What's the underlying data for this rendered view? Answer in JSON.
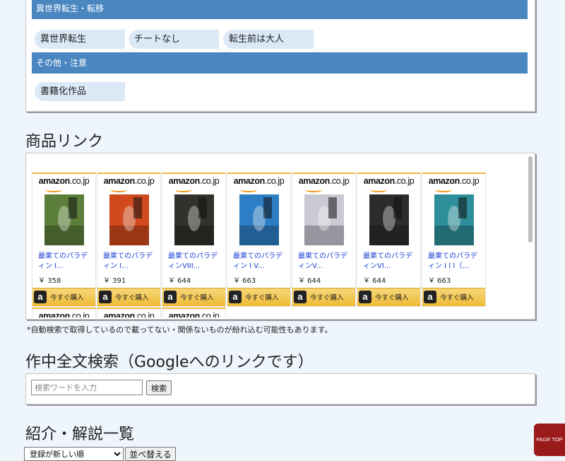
{
  "tags": {
    "category1": "異世界転生・転移",
    "category1_items": [
      "異世界転生",
      "チートなし",
      "転生前は大人"
    ],
    "category2": "その他・注意",
    "category2_items": [
      "書籍化作品"
    ]
  },
  "products_section": {
    "title": "商品リンク",
    "logo_main": "amazon",
    "logo_suffix": ".co.jp",
    "buy_label": "今すぐ購入",
    "buy_icon": "a",
    "items": [
      {
        "title": "最果てのパラディン I...",
        "price": "￥ 358",
        "cover_color": "#5b7f3a"
      },
      {
        "title": "最果てのパラディン I...",
        "price": "￥ 391",
        "cover_color": "#d04a1e"
      },
      {
        "title": "最果てのパラディンVIII...",
        "price": "￥ 644",
        "cover_color": "#33312c"
      },
      {
        "title": "最果てのパラディン I V...",
        "price": "￥ 663",
        "cover_color": "#2d7ec4"
      },
      {
        "title": "最果てのパラディンV...",
        "price": "￥ 644",
        "cover_color": "#c9c9d4"
      },
      {
        "title": "最果てのパラディンVI...",
        "price": "￥ 644",
        "cover_color": "#2c2c2c"
      },
      {
        "title": "最果てのパラディン I I I（...",
        "price": "￥ 663",
        "cover_color": "#2e8f9a"
      }
    ],
    "note": "*自動検索で取得しているので載ってない・関係ないものが紛れ込む可能性もあります。"
  },
  "search_section": {
    "title": "作中全文検索（Googleへのリンクです）",
    "placeholder": "検索ワードを入力",
    "button": "検索"
  },
  "reviews_section": {
    "title": "紹介・解説一覧",
    "sort_selected": "登録が新しい順",
    "sort_button": "並べ替える"
  },
  "page_top": "PAGE TOP"
}
